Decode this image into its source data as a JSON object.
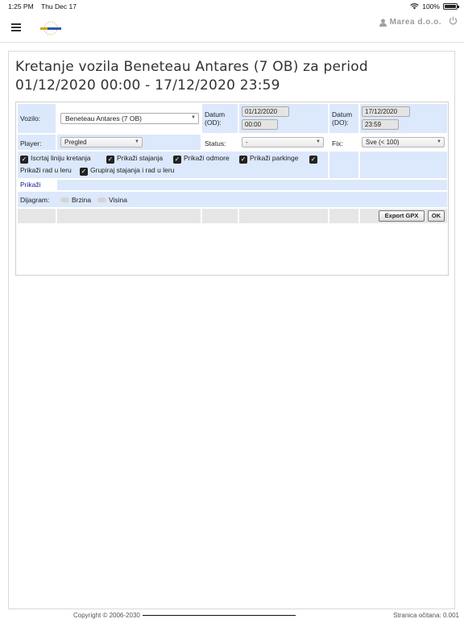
{
  "status_bar": {
    "time": "1:25 PM",
    "date": "Thu Dec 17",
    "battery": "100%",
    "icons": [
      "wifi-icon",
      "battery-icon"
    ]
  },
  "header": {
    "user": "Marea d.o.o.",
    "icons": [
      "menu-icon",
      "user-icon",
      "power-icon"
    ]
  },
  "page": {
    "title": "Kretanje vozila Beneteau Antares (7 OB) za period 01/12/2020 00:00 - 17/12/2020 23:59"
  },
  "form": {
    "vozilo_label": "Vozilo:",
    "vozilo_value": "Beneteau Antares (7 OB)",
    "datum_od_label": "Datum (OD):",
    "datum_od_date": "01/12/2020",
    "datum_od_time": "00:00",
    "datum_do_label": "Datum (DO):",
    "datum_do_date": "17/12/2020",
    "datum_do_time": "23:59",
    "player_label": "Player:",
    "player_value": "Pregled",
    "status_label": "Status:",
    "status_value": "-",
    "fix_label": "Fix:",
    "fix_value": "Sve (< 100)",
    "checkboxes": [
      {
        "label": "Iscrtaj liniju kretanja",
        "checked": true
      },
      {
        "label": "Prikaži stajanja",
        "checked": true
      },
      {
        "label": "Prikaži odmore",
        "checked": true
      },
      {
        "label": "Prikaži parkinge",
        "checked": true
      },
      {
        "label": "Prikaži rad u leru",
        "checked": false
      },
      {
        "label": "Grupiraj stajanja i rad u leru",
        "checked": true
      }
    ],
    "prikazi_link": "Prikaži",
    "dijagram_label": "Dijagram:",
    "dijagram_options": [
      "Brzina",
      "Visina"
    ],
    "export_button": "Export GPX",
    "ok_button": "OK"
  },
  "footer": {
    "copyright": "Copyright © 2006-2030",
    "page_load": "Stranica očitana: 0.001"
  }
}
